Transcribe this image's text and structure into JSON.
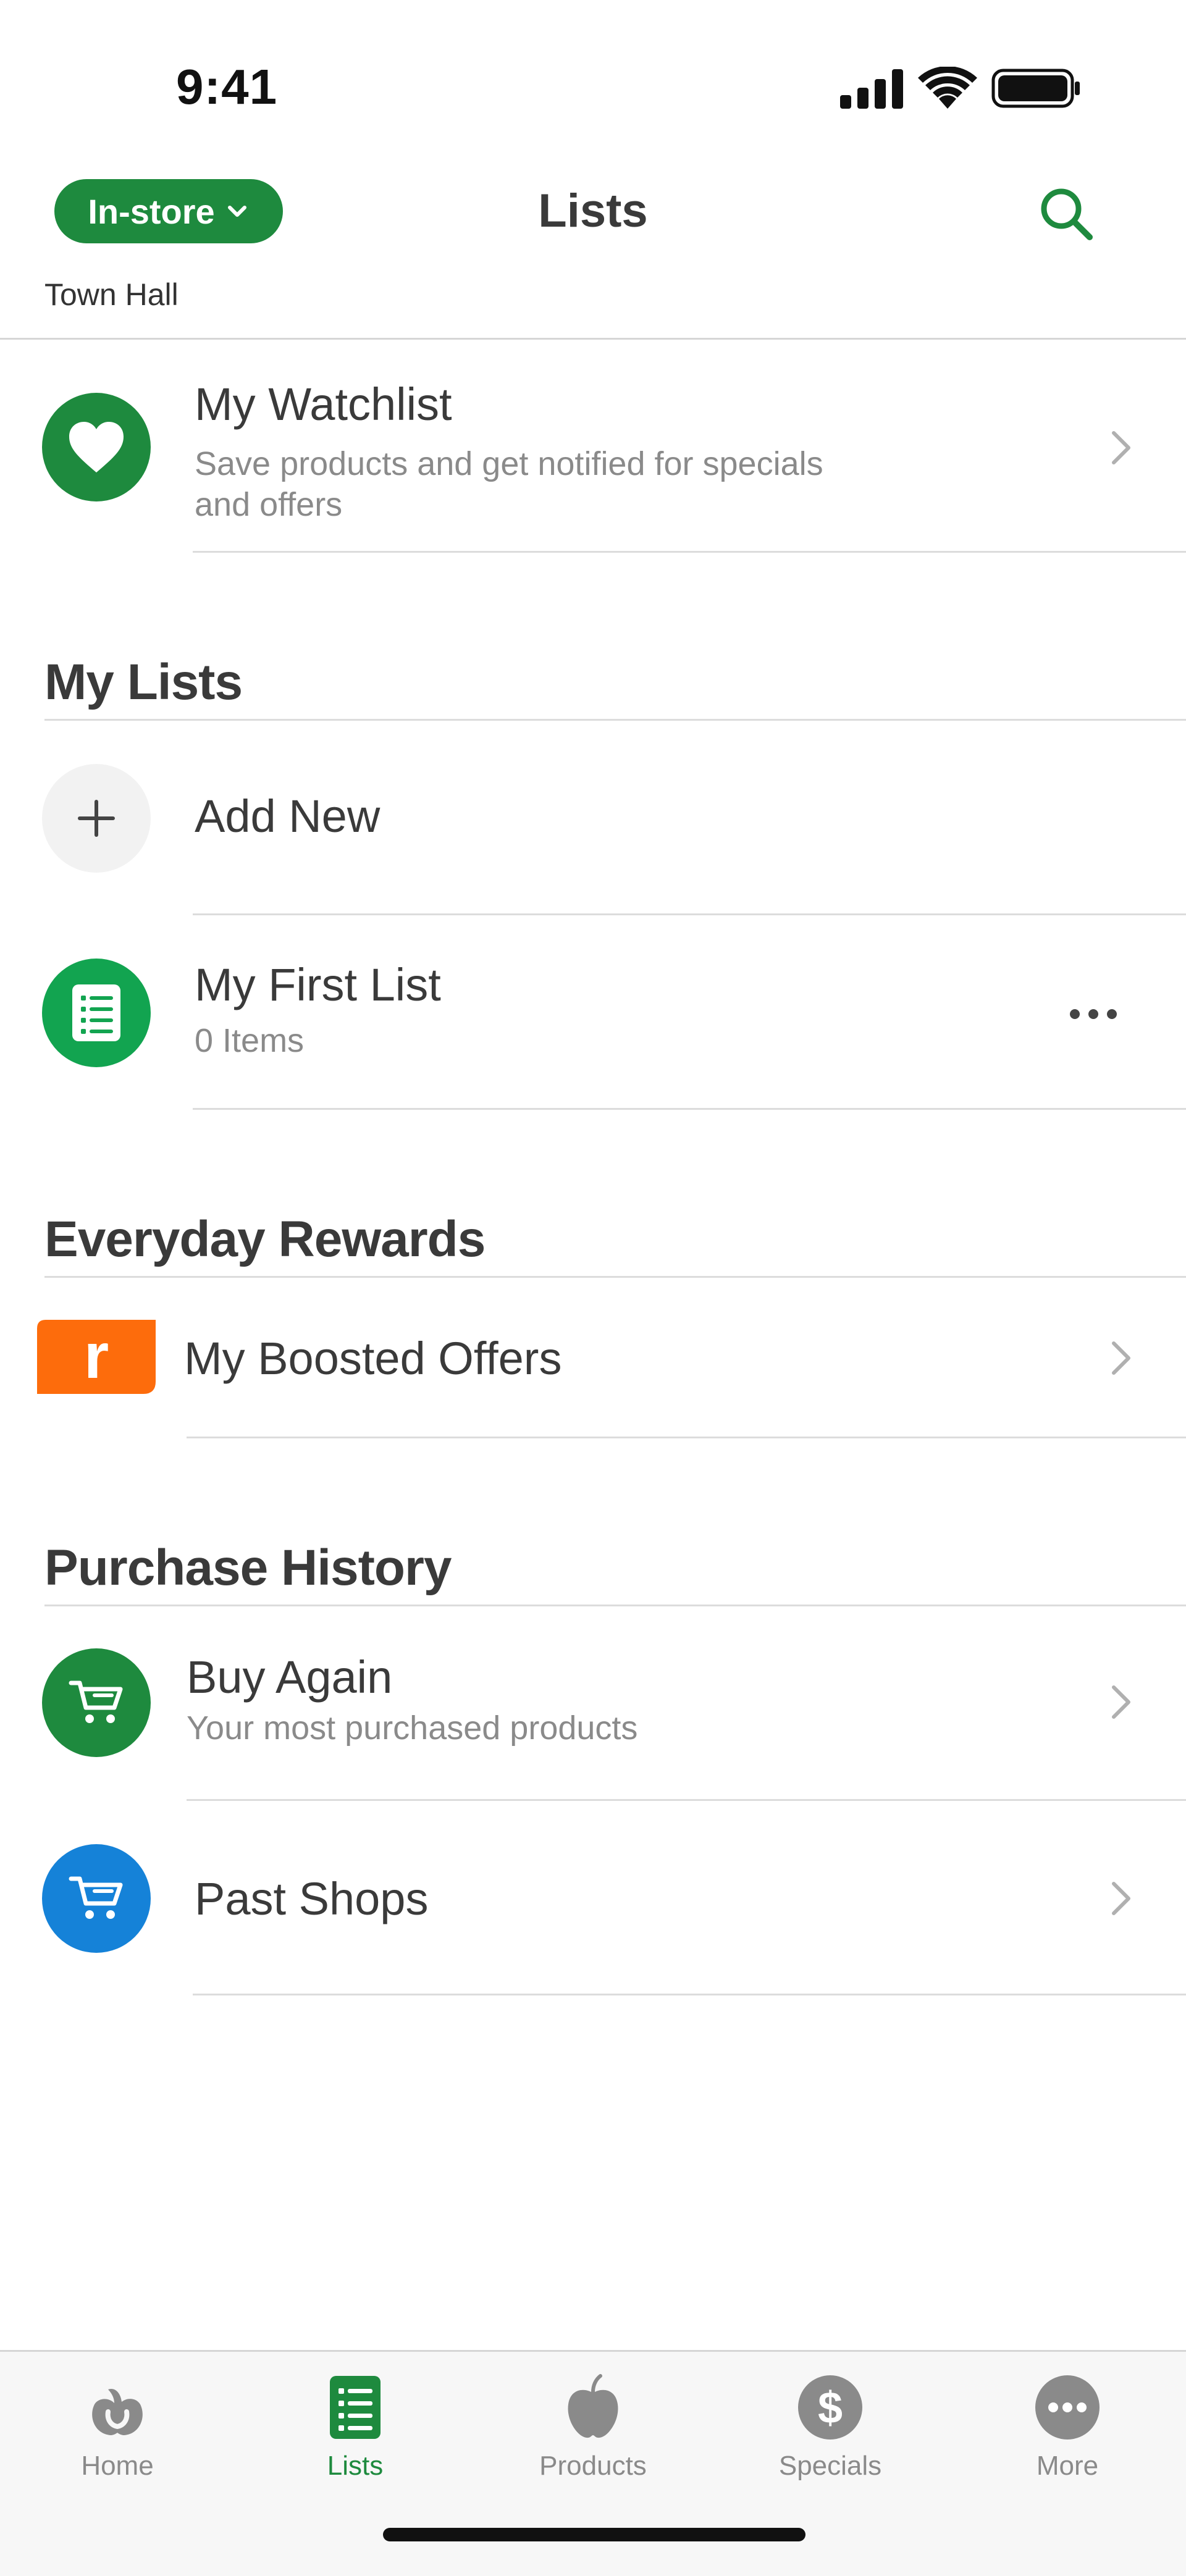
{
  "status_bar": {
    "time": "9:41"
  },
  "header": {
    "mode_label": "In-store",
    "title": "Lists",
    "store": "Town Hall"
  },
  "watchlist": {
    "title": "My Watchlist",
    "subtitle_line1": "Save products and get notified for specials",
    "subtitle_line2": "and offers"
  },
  "my_lists": {
    "heading": "My Lists",
    "add_new": "Add New",
    "lists": [
      {
        "title": "My First List",
        "subtitle": "0 Items"
      }
    ]
  },
  "rewards": {
    "heading": "Everyday Rewards",
    "boosted_offers": "My Boosted Offers",
    "logo_letter": "r"
  },
  "purchase_history": {
    "heading": "Purchase History",
    "buy_again": {
      "title": "Buy Again",
      "subtitle": "Your most purchased products"
    },
    "past_shops": {
      "title": "Past Shops"
    }
  },
  "tabs": [
    {
      "label": "Home",
      "icon": "woolworths-logo-icon",
      "active": false
    },
    {
      "label": "Lists",
      "icon": "list-icon",
      "active": true
    },
    {
      "label": "Products",
      "icon": "apple-icon",
      "active": false
    },
    {
      "label": "Specials",
      "icon": "dollar-icon",
      "active": false
    },
    {
      "label": "More",
      "icon": "more-icon",
      "active": false
    }
  ],
  "colors": {
    "brand_green": "#1e8a3e",
    "list_green": "#12a450",
    "rewards_orange": "#fd6c0c",
    "past_shops_blue": "#1582d8",
    "inactive_gray": "#8a8a8a"
  }
}
